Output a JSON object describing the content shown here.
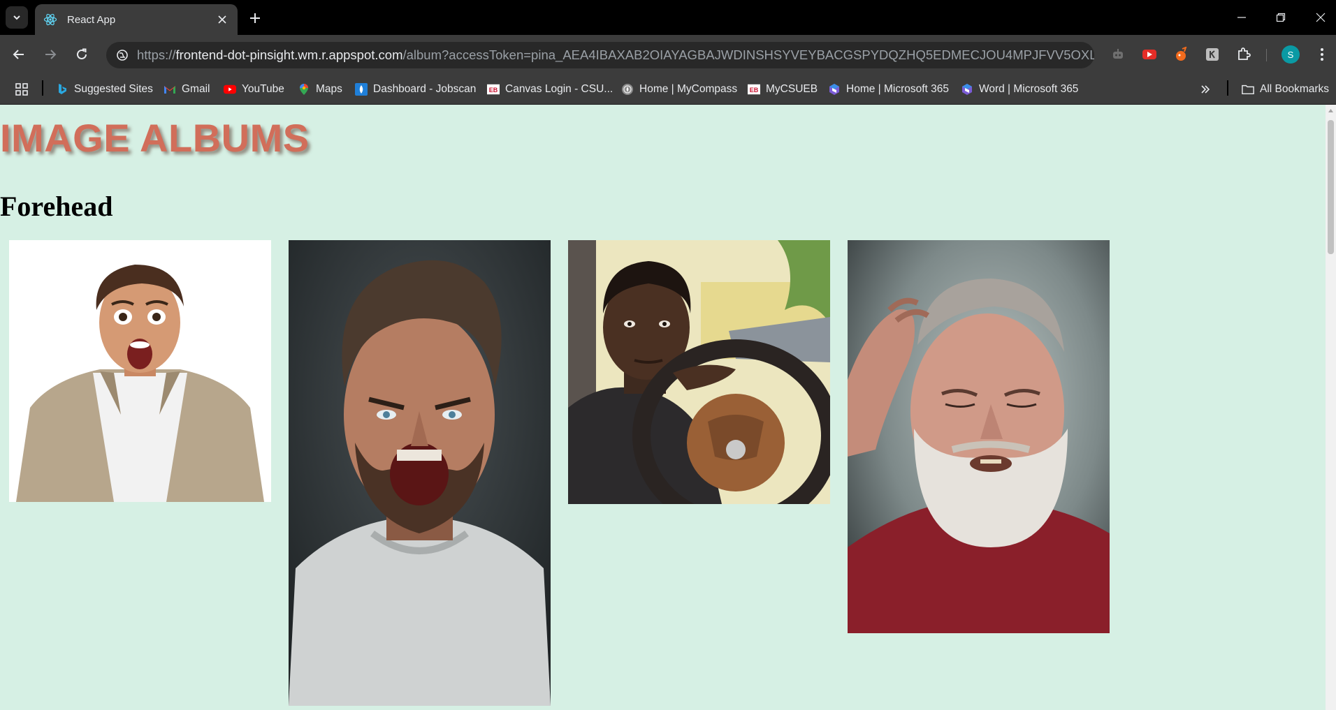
{
  "browser": {
    "tab_title": "React App",
    "url_scheme": "https://",
    "url_host": "frontend-dot-pinsight.wm.r.appspot.com",
    "url_path": "/album?accessToken=pina_AEA4IBAXAB2OIAYAGBAJWDINSHSYVEYBACGSPYDQZHQ5EDMECJOU4MPJFVV5OXLB5YGGVOPI...",
    "profile_initial": "S"
  },
  "bookmarks": [
    {
      "label": "Suggested Sites",
      "icon": "bing-icon"
    },
    {
      "label": "Gmail",
      "icon": "gmail-icon"
    },
    {
      "label": "YouTube",
      "icon": "youtube-icon"
    },
    {
      "label": "Maps",
      "icon": "maps-icon"
    },
    {
      "label": "Dashboard - Jobscan",
      "icon": "jobscan-icon"
    },
    {
      "label": "Canvas Login - CSU...",
      "icon": "eb-icon"
    },
    {
      "label": "Home | MyCompass",
      "icon": "mycompass-icon"
    },
    {
      "label": "MyCSUEB",
      "icon": "eb-icon"
    },
    {
      "label": "Home | Microsoft 365",
      "icon": "microsoft365-icon"
    },
    {
      "label": "Word | Microsoft 365",
      "icon": "microsoft365-icon"
    }
  ],
  "all_bookmarks_label": "All Bookmarks",
  "page": {
    "app_title": "IMAGE ALBUMS",
    "album_name": "Forehead",
    "images": [
      {
        "name": "surprised-man-photo",
        "description": "shocked young man in plaid shirt"
      },
      {
        "name": "angry-man-photo",
        "description": "bearded man screaming"
      },
      {
        "name": "young-man-car-photo",
        "description": "young man at steering wheel"
      },
      {
        "name": "old-man-beard-photo",
        "description": "old bearded man scratching head"
      }
    ]
  },
  "colors": {
    "page_bg": "#d6f0e4",
    "title_color": "#d16e5a",
    "chrome_dark": "#3c3c3c"
  }
}
